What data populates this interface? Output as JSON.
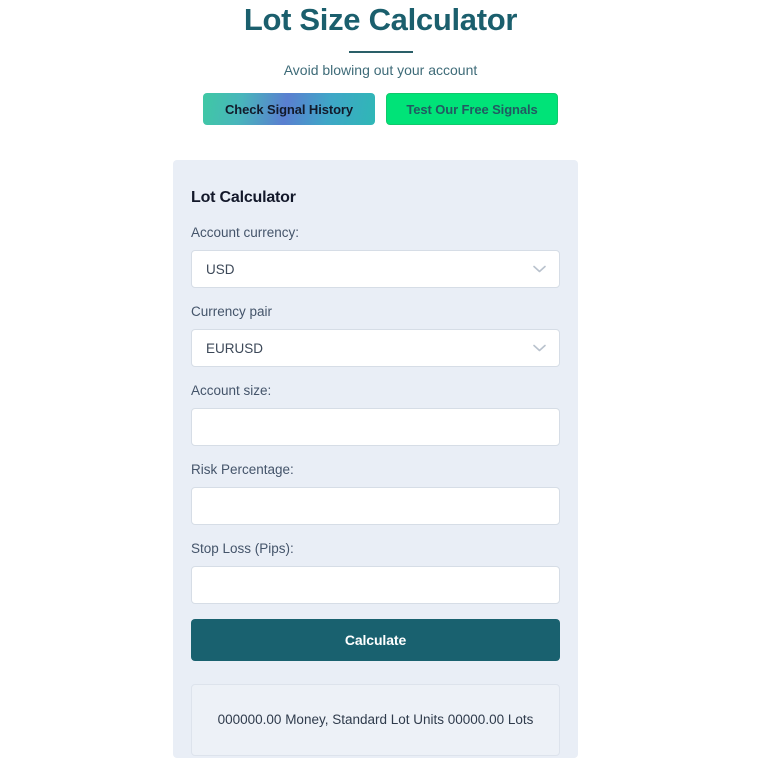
{
  "header": {
    "title": "Lot Size Calculator",
    "subtitle": "Avoid blowing out your account",
    "buttons": {
      "signal_history": "Check Signal History",
      "free_signals": "Test Our Free Signals"
    }
  },
  "calculator": {
    "title": "Lot Calculator",
    "fields": {
      "account_currency": {
        "label": "Account currency:",
        "value": "USD",
        "icon": "chevron-down-icon"
      },
      "currency_pair": {
        "label": "Currency pair",
        "value": "EURUSD",
        "icon": "chevron-down-icon"
      },
      "account_size": {
        "label": "Account size:",
        "value": "",
        "placeholder": ""
      },
      "risk_percentage": {
        "label": "Risk Percentage:",
        "value": "",
        "placeholder": ""
      },
      "stop_loss": {
        "label": "Stop Loss (Pips):",
        "value": "",
        "placeholder": ""
      }
    },
    "calculate_button": "Calculate",
    "result": "000000.00 Money, Standard Lot Units 00000.00 Lots"
  },
  "colors": {
    "title_teal": "#1b5f6d",
    "card_bg": "#e9eef6",
    "calculate_btn": "#19616f",
    "green_btn": "#00e378",
    "gradient_start": "#3fc8a4",
    "gradient_mid": "#5a7fd0",
    "gradient_end": "#2fb7b6",
    "page_bg": "#ffffff"
  }
}
